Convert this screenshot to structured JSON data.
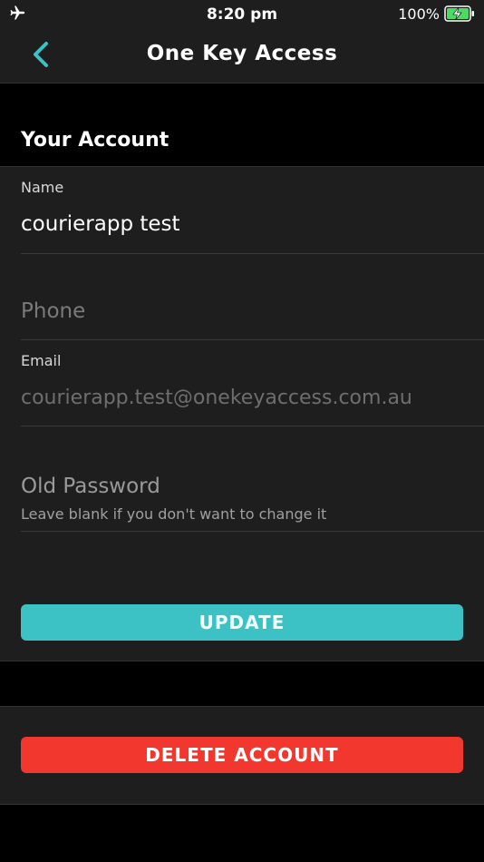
{
  "status_bar": {
    "time": "8:20 pm",
    "battery_percent": "100%",
    "airplane_icon": "airplane-icon",
    "battery_icon": "battery-charging-icon"
  },
  "nav": {
    "title": "One Key Access",
    "back_icon": "chevron-left-icon",
    "accent_color": "#3cc2c4"
  },
  "section": {
    "title": "Your Account"
  },
  "form": {
    "name": {
      "label": "Name",
      "value": "courierapp test"
    },
    "phone": {
      "placeholder": "Phone"
    },
    "email": {
      "label": "Email",
      "value": "courierapp.test@onekeyaccess.com.au"
    },
    "old_password": {
      "placeholder": "Old Password",
      "hint": "Leave blank if you don't want to change it"
    },
    "update_label": "UPDATE"
  },
  "danger": {
    "delete_label": "DELETE ACCOUNT",
    "color": "#f2382e"
  }
}
